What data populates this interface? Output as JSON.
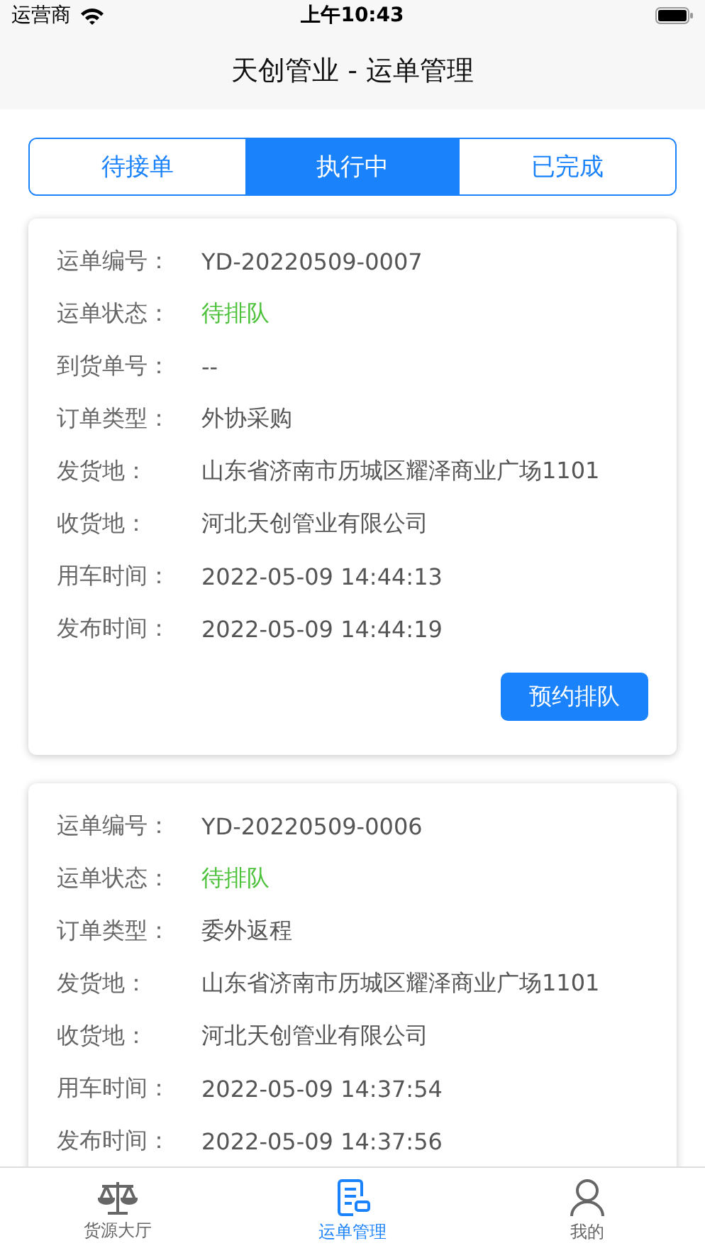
{
  "status_bar": {
    "carrier": "运营商",
    "time": "上午10:43"
  },
  "title": "天创管业 - 运单管理",
  "tabs": [
    {
      "label": "待接单",
      "selected": false
    },
    {
      "label": "执行中",
      "selected": true
    },
    {
      "label": "已完成",
      "selected": false
    }
  ],
  "orders": [
    {
      "fields": [
        {
          "label": "运单编号：",
          "value": "YD-20220509-0007",
          "kind": "text"
        },
        {
          "label": "运单状态：",
          "value": "待排队",
          "kind": "status"
        },
        {
          "label": "到货单号：",
          "value": "--",
          "kind": "text"
        },
        {
          "label": "订单类型：",
          "value": "外协采购",
          "kind": "text"
        },
        {
          "label": "发货地：",
          "value": "山东省济南市历城区耀泽商业广场1101",
          "kind": "text"
        },
        {
          "label": "收货地：",
          "value": "河北天创管业有限公司",
          "kind": "text"
        },
        {
          "label": "用车时间：",
          "value": "2022-05-09 14:44:13",
          "kind": "text"
        },
        {
          "label": "发布时间：",
          "value": "2022-05-09 14:44:19",
          "kind": "text"
        }
      ],
      "action": "预约排队"
    },
    {
      "fields": [
        {
          "label": "运单编号：",
          "value": "YD-20220509-0006",
          "kind": "text"
        },
        {
          "label": "运单状态：",
          "value": "待排队",
          "kind": "status"
        },
        {
          "label": "订单类型：",
          "value": "委外返程",
          "kind": "text"
        },
        {
          "label": "发货地：",
          "value": "山东省济南市历城区耀泽商业广场1101",
          "kind": "text"
        },
        {
          "label": "收货地：",
          "value": "河北天创管业有限公司",
          "kind": "text"
        },
        {
          "label": "用车时间：",
          "value": "2022-05-09 14:37:54",
          "kind": "text"
        },
        {
          "label": "发布时间：",
          "value": "2022-05-09 14:37:56",
          "kind": "text"
        }
      ]
    }
  ],
  "tab_bar": [
    {
      "label": "货源大厅",
      "selected": false
    },
    {
      "label": "运单管理",
      "selected": true
    },
    {
      "label": "我的",
      "selected": false
    }
  ]
}
